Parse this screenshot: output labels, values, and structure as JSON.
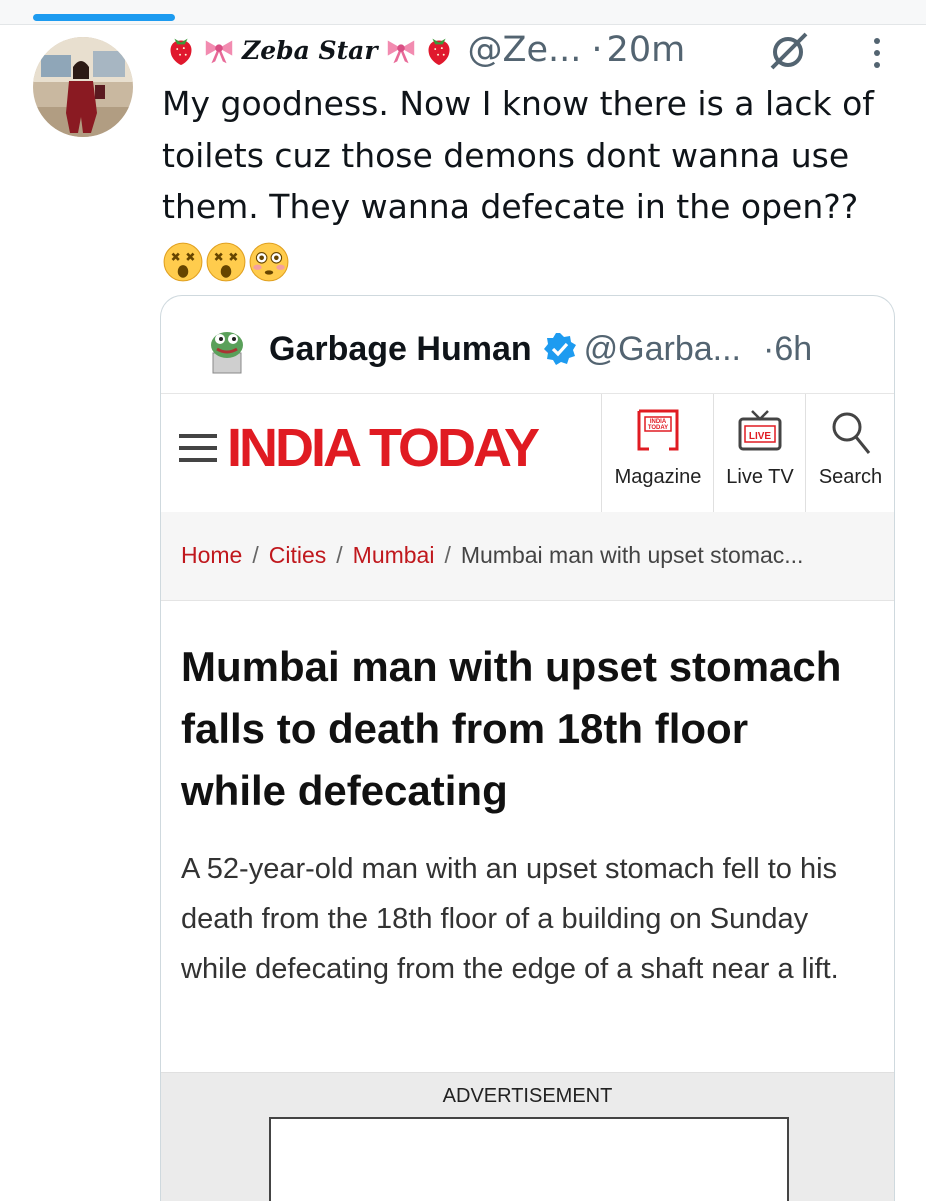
{
  "tweet": {
    "author_name": "Zeba Star",
    "handle": "@Ze...",
    "time": "20m",
    "text": "My goodness. Now I know there is a lack of toilets cuz those demons dont wanna use them. They wanna defecate in the open??",
    "emojis": [
      "dizzy-face",
      "dizzy-face",
      "flushed-face"
    ]
  },
  "quoted": {
    "author_name": "Garbage Human",
    "handle": "@Garba...",
    "time": "6h",
    "verified": true
  },
  "article": {
    "site_logo": "INDIA TODAY",
    "nav": [
      {
        "label": "Magazine",
        "icon": "magazine-icon"
      },
      {
        "label": "Live TV",
        "icon": "live-tv-icon",
        "badge": "LIVE"
      },
      {
        "label": "Search",
        "icon": "search-icon"
      }
    ],
    "breadcrumb": [
      "Home",
      "Cities",
      "Mumbai",
      "Mumbai man with upset stomac..."
    ],
    "headline": "Mumbai man with upset stomach falls to death from 18th floor while defecating",
    "summary": "A 52-year-old man with an upset stomach fell to his death from the 18th floor of a building on Sunday while defecating from the edge of a shaft near a lift.",
    "ad_label": "ADVERTISEMENT"
  },
  "colors": {
    "accent": "#1d9bf0",
    "brand_red": "#e01b22",
    "text": "#0f1419",
    "muted": "#536471"
  }
}
